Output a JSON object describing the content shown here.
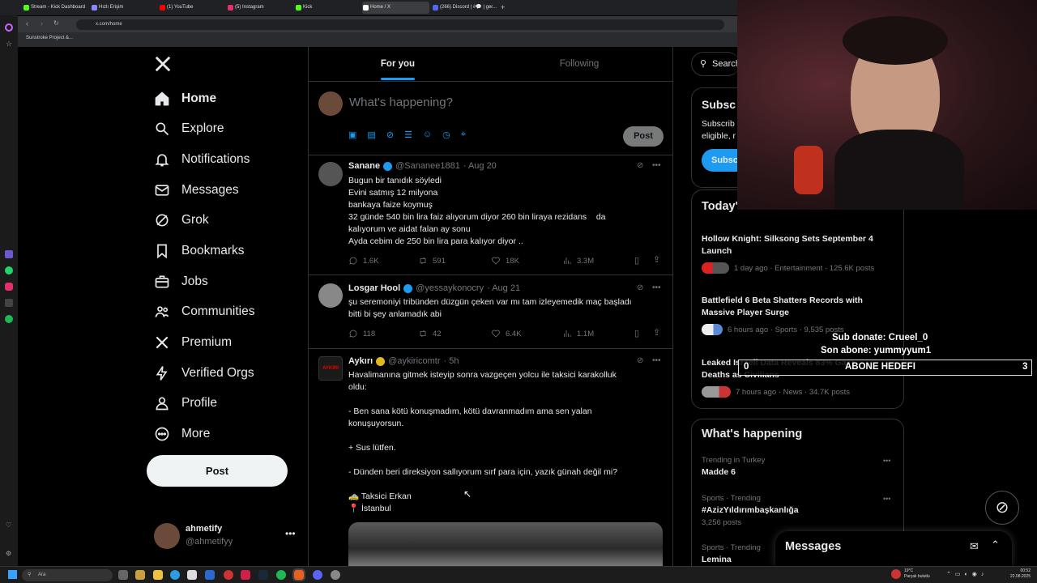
{
  "browser": {
    "tabs": [
      {
        "label": "Stream - Kick Dashboard",
        "color": "#53fc18"
      },
      {
        "label": "Hızlı Erişim",
        "color": "#8888ff"
      },
      {
        "label": "(1) YouTube",
        "color": "#ff0000"
      },
      {
        "label": "(5) Instagram",
        "color": "#e1306c"
      },
      {
        "label": "Kick",
        "color": "#53fc18"
      },
      {
        "label": "Home / X",
        "color": "#ffffff"
      },
      {
        "label": "(266) Discord | #💬 | ger...",
        "color": "#5865f2"
      }
    ],
    "url": "x.com/home",
    "bookmark": "Sunstroke Project &..."
  },
  "sidebar": {
    "items": [
      {
        "label": "Home",
        "icon": "home-icon"
      },
      {
        "label": "Explore",
        "icon": "search-icon"
      },
      {
        "label": "Notifications",
        "icon": "bell-icon"
      },
      {
        "label": "Messages",
        "icon": "mail-icon"
      },
      {
        "label": "Grok",
        "icon": "grok-icon"
      },
      {
        "label": "Bookmarks",
        "icon": "bookmark-icon"
      },
      {
        "label": "Jobs",
        "icon": "briefcase-icon"
      },
      {
        "label": "Communities",
        "icon": "people-icon"
      },
      {
        "label": "Premium",
        "icon": "x-logo-icon"
      },
      {
        "label": "Verified Orgs",
        "icon": "lightning-icon"
      },
      {
        "label": "Profile",
        "icon": "person-icon"
      },
      {
        "label": "More",
        "icon": "more-circle-icon"
      }
    ],
    "post_label": "Post",
    "account": {
      "name": "ahmetify",
      "handle": "@ahmetifyy"
    }
  },
  "feed": {
    "tabs": [
      {
        "label": "For you"
      },
      {
        "label": "Following"
      }
    ],
    "compose_placeholder": "What's happening?",
    "post_label": "Post",
    "tweets": [
      {
        "name": "Sanane",
        "handle": "@Sananee1881",
        "time": "· Aug 20",
        "lines": [
          "Bugun bir tanıdık söyledi",
          "Evini satmış 12 milyona",
          "bankaya faize koymuş",
          "32 günde 540 bin lira faiz alıyorum diyor 260 bin liraya rezidans    da",
          "kalıyorum ve aidat falan ay sonu",
          "Ayda cebim de 250 bin lira para kalıyor diyor .."
        ],
        "replies": "1.6K",
        "reposts": "591",
        "likes": "18K",
        "views": "3.3M"
      },
      {
        "name": "Losgar Hool",
        "handle": "@yessaykonocry",
        "time": "· Aug 21",
        "lines": [
          "şu seremoniyi tribünden düzgün çeken var mı tam izleyemedik maç başladı",
          "bitti bi şey anlamadık abi"
        ],
        "replies": "118",
        "reposts": "42",
        "likes": "6.4K",
        "views": "1.1M"
      },
      {
        "name": "Aykırı",
        "handle": "@aykiricomtr",
        "time": "· 5h",
        "avatar_text": "AYKIRI",
        "lines": [
          "Havalimanına gitmek isteyip sonra vazgeçen yolcu ile taksici karakolluk",
          "oldu:",
          "",
          "- Ben sana kötü konuşmadım, kötü davranmadım ama sen yalan",
          "konuşuyorsun.",
          "",
          "+ Sus lütfen.",
          "",
          "- Dünden beri direksiyon sallıyorum sırf para için, yazık günah değil mi?",
          "",
          "🚕 Taksici Erkan",
          "📍 İstanbul"
        ]
      }
    ]
  },
  "right": {
    "search_placeholder": "Search",
    "subscribe": {
      "title": "Subsc",
      "text1": "Subscrib",
      "text2": "eligible, r",
      "button": "Subsc"
    },
    "news_title": "Today's News",
    "news": [
      {
        "title1": "Hollow Knight: Silksong Sets September 4",
        "title2": "Launch",
        "meta": "1 day ago · Entertainment · 125.6K posts"
      },
      {
        "title1": "Battlefield 6 Beta Shatters Records with",
        "title2": "Massive Player Surge",
        "meta": "6 hours ago · Sports · 9,535 posts"
      },
      {
        "title1": "Leaked Israeli Data Reveals 83% Gaza",
        "title2": "Deaths as Civilians",
        "meta": "7 hours ago · News · 34.7K posts"
      }
    ],
    "whats_happening": "What's happening",
    "trends": [
      {
        "context": "Trending in Turkey",
        "title": "Madde 6",
        "posts": ""
      },
      {
        "context": "Sports · Trending",
        "title": "#AzizYıldırımbaşkanlığa",
        "posts": "3,256 posts"
      },
      {
        "context": "Sports · Trending",
        "title": "Lemina",
        "posts": ""
      }
    ],
    "messages_title": "Messages"
  },
  "overlay": {
    "sub_donate": "Sub donate: Crueel_0",
    "son_abone": "Son abone: yummyyum1",
    "goal_label": "ABONE HEDEFI",
    "goal_start": "0",
    "goal_end": "3",
    "goal_progress": 0
  },
  "taskbar": {
    "search": "Ara",
    "weather_temp": "19°C",
    "weather_desc": "Parçalı bulutlu",
    "time": "00:52",
    "date": "22.08.2025"
  }
}
